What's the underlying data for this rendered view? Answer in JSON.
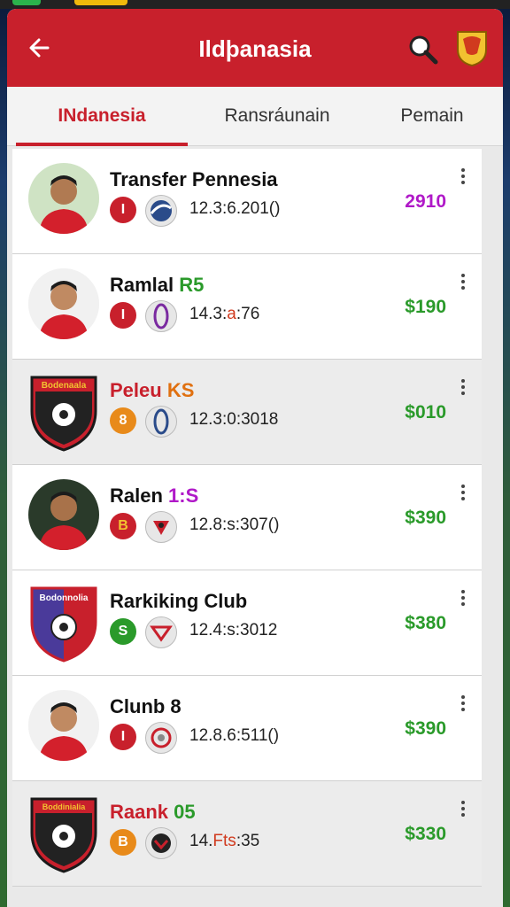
{
  "header": {
    "title": "Ildþanasia"
  },
  "tabs": [
    {
      "label": "INdanesia",
      "active": true
    },
    {
      "label": "Ransráunain",
      "active": false
    },
    {
      "label": "Pemain",
      "active": false
    }
  ],
  "rows": [
    {
      "name": "Transfer Pennesia",
      "badge": "I",
      "badge_color": "#c8202c",
      "date": "12.3:6.201()",
      "value": "2910",
      "value_color": "#b019c8",
      "icon": "player-avatar-icon"
    },
    {
      "name": "Ramlal",
      "name_accent": " R5",
      "badge": "I",
      "badge_color": "#c8202c",
      "date": "14.3:",
      "date_accent": "a",
      "date_rest": ":76",
      "value": "$190",
      "value_color": "#2a9a2a",
      "icon": "player-avatar-icon"
    },
    {
      "name": "Peleu",
      "name_accent": " KS",
      "badge": "8",
      "badge_color": "#e88a1a",
      "date": "12.3:0:3018",
      "value": "$010",
      "value_color": "#2a9a2a",
      "icon": "club-crest-icon",
      "crest_text": "Bodenaala"
    },
    {
      "name": "Ralen",
      "name_accent": " 1:S",
      "badge": "B",
      "badge_color": "#c8202c",
      "date": "12.8:s:307()",
      "value": "$390",
      "value_color": "#2a9a2a",
      "icon": "player-avatar-icon"
    },
    {
      "name": "Rarkiking Club",
      "badge": "S",
      "badge_color": "#2a9a2a",
      "date": "12.4:s:3012",
      "value": "$380",
      "value_color": "#2a9a2a",
      "icon": "club-crest-icon",
      "crest_text": "Bodonnolia"
    },
    {
      "name": "Clunb 8",
      "badge": "I",
      "badge_color": "#c8202c",
      "date": "12.8.6:511()",
      "value": "$390",
      "value_color": "#2a9a2a",
      "icon": "player-avatar-icon"
    },
    {
      "name": "Raank",
      "name_accent": " 05",
      "badge": "B",
      "badge_color": "#e88a1a",
      "date": "14.",
      "date_accent": "Fts",
      "date_rest": ":35",
      "value": "$330",
      "value_color": "#2a9a2a",
      "icon": "club-crest-icon",
      "crest_text": "Boddinialia"
    }
  ]
}
